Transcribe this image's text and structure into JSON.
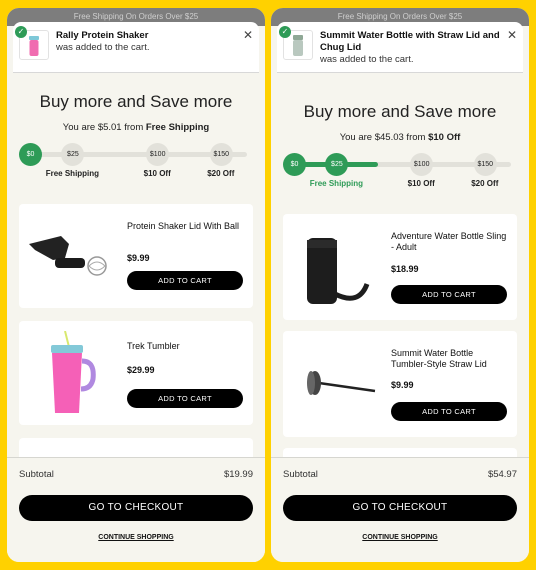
{
  "colors": {
    "background": "#FFD100",
    "accent_green": "#2e9b57",
    "button_black": "#000000"
  },
  "left": {
    "shipping_banner": "Free Shipping On Orders Over $25",
    "notification": {
      "product": "Rally Protein Shaker",
      "message": "was added to the cart.",
      "close_icon": "close-icon"
    },
    "headline": "Buy more and Save more",
    "remaining": {
      "prefix": "You are $5.01 from",
      "goal": "Free Shipping"
    },
    "progress": {
      "fraction": 0.0,
      "milestones": [
        {
          "value": "$0",
          "label": "",
          "reached": true
        },
        {
          "value": "$25",
          "label": "Free Shipping",
          "reached": false
        },
        {
          "value": "$100",
          "label": "$10 Off",
          "reached": false
        },
        {
          "value": "$150",
          "label": "$20 Off",
          "reached": false
        }
      ]
    },
    "products": [
      {
        "name": "Protein Shaker Lid With Ball",
        "price": "$9.99",
        "button": "ADD TO CART"
      },
      {
        "name": "Trek Tumbler",
        "price": "$29.99",
        "button": "ADD TO CART"
      }
    ],
    "subtotal_label": "Subtotal",
    "subtotal_value": "$19.99",
    "checkout": "GO TO CHECKOUT",
    "continue": "CONTINUE SHOPPING"
  },
  "right": {
    "shipping_banner": "Free Shipping On Orders Over $25",
    "notification": {
      "product": "Summit Water Bottle with Straw Lid and Chug Lid",
      "message": "was added to the cart.",
      "close_icon": "close-icon"
    },
    "headline": "Buy more and Save more",
    "remaining": {
      "prefix": "You are $45.03 from",
      "goal": "$10 Off"
    },
    "progress": {
      "fraction": 0.4,
      "milestones": [
        {
          "value": "$0",
          "label": "",
          "reached": true
        },
        {
          "value": "$25",
          "label": "Free Shipping",
          "reached": true
        },
        {
          "value": "$100",
          "label": "$10 Off",
          "reached": false
        },
        {
          "value": "$150",
          "label": "$20 Off",
          "reached": false
        }
      ]
    },
    "products": [
      {
        "name": "Adventure Water Bottle Sling - Adult",
        "price": "$18.99",
        "button": "ADD TO CART"
      },
      {
        "name": "Summit Water Bottle Tumbler-Style Straw Lid",
        "price": "$9.99",
        "button": "ADD TO CART"
      }
    ],
    "subtotal_label": "Subtotal",
    "subtotal_value": "$54.97",
    "checkout": "GO TO CHECKOUT",
    "continue": "CONTINUE SHOPPING"
  }
}
